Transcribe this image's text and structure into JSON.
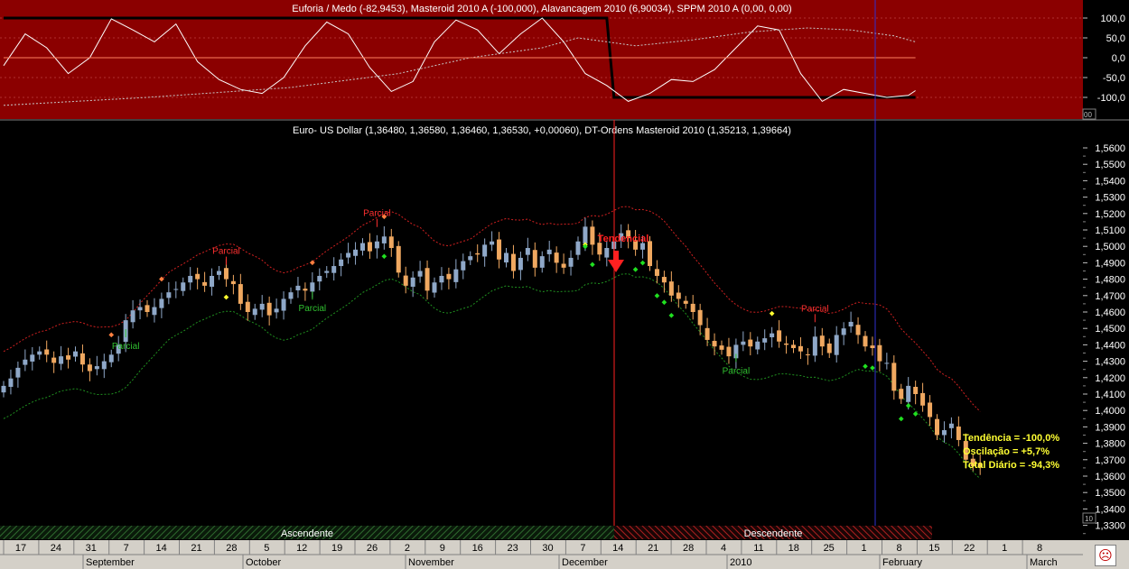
{
  "indicator_panel": {
    "title": "Euforia / Medo (-82,9453), Masteroid 2010 A (-100,000), Alavancagem 2010 (6,90034), SPPM 2010 A (0,00, 0,00)",
    "y_labels": [
      "100,0",
      "50,0",
      "0,0",
      "-50,0",
      "-100,0"
    ],
    "corner_label": "00"
  },
  "price_panel": {
    "title": "Euro- US Dollar (1,36480, 1,36580, 1,36460, 1,36530, +0,00060), DT-Ordens Masteroid 2010 (1,35213, 1,39664)",
    "corner_label": "10"
  },
  "annotations": {
    "parcial": "Parcial",
    "tendencial": "Tendencial",
    "ascendente": "Ascendente",
    "descendente": "Descendente"
  },
  "info_box": {
    "tendencia": "Tendência = -100,0%",
    "oscilacao": "Oscilação = +5,7%",
    "total": "Total Diário = -94,3%"
  },
  "status_icon": "sad-face-icon",
  "colors": {
    "indicator_bg": "#8b0000",
    "up_candle": "#8fa8c8",
    "down_candle": "#f0a860",
    "signal_line": "#ff2020",
    "event_line": "#3030d0",
    "info_text": "#ffff33"
  },
  "chart_data": [
    {
      "type": "line",
      "title": "Euforia / Medo (-82,9453), Masteroid 2010 A (-100,000), Alavancagem 2010 (6,90034), SPPM 2010 A (0,00, 0,00)",
      "ylim": [
        -135,
        135
      ],
      "yticks": [
        100,
        50,
        0,
        -50,
        -100
      ],
      "series": [
        {
          "name": "Masteroid 2010 A",
          "color": "#000000",
          "points": [
            [
              0,
              100
            ],
            [
              84,
              100
            ],
            [
              85,
              -100
            ],
            [
              127,
              -100
            ]
          ]
        },
        {
          "name": "Euforia / Medo",
          "color": "#ffffff",
          "points": [
            [
              0,
              -20
            ],
            [
              3,
              60
            ],
            [
              6,
              25
            ],
            [
              9,
              -40
            ],
            [
              12,
              0
            ],
            [
              15,
              98
            ],
            [
              18,
              70
            ],
            [
              21,
              40
            ],
            [
              24,
              85
            ],
            [
              27,
              -10
            ],
            [
              30,
              -55
            ],
            [
              33,
              -80
            ],
            [
              36,
              -90
            ],
            [
              39,
              -50
            ],
            [
              42,
              30
            ],
            [
              45,
              90
            ],
            [
              48,
              60
            ],
            [
              51,
              -25
            ],
            [
              54,
              -85
            ],
            [
              57,
              -60
            ],
            [
              60,
              40
            ],
            [
              63,
              95
            ],
            [
              66,
              70
            ],
            [
              69,
              10
            ],
            [
              72,
              60
            ],
            [
              75,
              100
            ],
            [
              78,
              40
            ],
            [
              81,
              -40
            ],
            [
              84,
              -70
            ],
            [
              87,
              -110
            ],
            [
              90,
              -90
            ],
            [
              93,
              -55
            ],
            [
              96,
              -60
            ],
            [
              99,
              -30
            ],
            [
              102,
              25
            ],
            [
              105,
              80
            ],
            [
              108,
              70
            ],
            [
              111,
              -40
            ],
            [
              114,
              -110
            ],
            [
              117,
              -80
            ],
            [
              120,
              -90
            ],
            [
              123,
              -100
            ],
            [
              126,
              -95
            ],
            [
              127,
              -83
            ]
          ]
        },
        {
          "name": "SPPM 2010 A",
          "color": "#c8c8c8",
          "points": [
            [
              0,
              -120
            ],
            [
              20,
              -100
            ],
            [
              40,
              -75
            ],
            [
              55,
              -40
            ],
            [
              65,
              0
            ],
            [
              75,
              25
            ],
            [
              80,
              50
            ],
            [
              88,
              30
            ],
            [
              96,
              45
            ],
            [
              104,
              65
            ],
            [
              112,
              75
            ],
            [
              118,
              70
            ],
            [
              124,
              55
            ],
            [
              127,
              40
            ]
          ]
        },
        {
          "name": "Alavancagem 2010",
          "color": "#ff8060",
          "points": [
            [
              0,
              0
            ],
            [
              127,
              0
            ]
          ]
        }
      ]
    },
    {
      "type": "candlestick",
      "title": "Euro- US Dollar (1,36480, 1,36580, 1,36460, 1,36530, +0,00060), DT-Ordens Masteroid 2010 (1,35213, 1,39664)",
      "ylim": [
        1.327,
        1.5685
      ],
      "yticks": [
        "1,5600",
        "1,5500",
        "1,5400",
        "1,5300",
        "1,5200",
        "1,5100",
        "1,5000",
        "1,4900",
        "1,4800",
        "1,4700",
        "1,4600",
        "1,4500",
        "1,4400",
        "1,4300",
        "1,4200",
        "1,4100",
        "1,4000",
        "1,3900",
        "1,3800",
        "1,3700",
        "1,3600",
        "1,3500",
        "1,3400",
        "1,3300"
      ],
      "x_day_labels": [
        "17",
        "24",
        "31",
        "7",
        "14",
        "21",
        "28",
        "5",
        "12",
        "19",
        "26",
        "2",
        "9",
        "16",
        "23",
        "30",
        "7",
        "14",
        "21",
        "28",
        "4",
        "11",
        "18",
        "25",
        "1",
        "8",
        "15",
        "22",
        "1",
        "8"
      ],
      "x_month_labels": [
        "September",
        "October",
        "November",
        "December",
        "2010",
        "February",
        "March"
      ],
      "close": [
        1.415,
        1.4195,
        1.426,
        1.431,
        1.434,
        1.436,
        1.434,
        1.429,
        1.433,
        1.431,
        1.436,
        1.428,
        1.424,
        1.427,
        1.43,
        1.434,
        1.44,
        1.455,
        1.461,
        1.463,
        1.46,
        1.463,
        1.468,
        1.472,
        1.474,
        1.478,
        1.482,
        1.48,
        1.476,
        1.482,
        1.485,
        1.48,
        1.477,
        1.465,
        1.46,
        1.462,
        1.465,
        1.458,
        1.462,
        1.468,
        1.472,
        1.476,
        1.473,
        1.478,
        1.482,
        1.485,
        1.488,
        1.492,
        1.496,
        1.498,
        1.502,
        1.497,
        1.503,
        1.506,
        1.499,
        1.484,
        1.476,
        1.481,
        1.485,
        1.473,
        1.478,
        1.482,
        1.48,
        1.486,
        1.491,
        1.494,
        1.495,
        1.501,
        1.503,
        1.492,
        1.496,
        1.485,
        1.493,
        1.499,
        1.487,
        1.494,
        1.498,
        1.49,
        1.487,
        1.493,
        1.503,
        1.512,
        1.501,
        1.495,
        1.499,
        1.503,
        1.508,
        1.505,
        1.498,
        1.502,
        1.488,
        1.482,
        1.478,
        1.47,
        1.468,
        1.465,
        1.46,
        1.452,
        1.443,
        1.439,
        1.437,
        1.433,
        1.44,
        1.442,
        1.439,
        1.442,
        1.444,
        1.447,
        1.442,
        1.44,
        1.438,
        1.436,
        1.434,
        1.445,
        1.439,
        1.435,
        1.446,
        1.45,
        1.454,
        1.446,
        1.439,
        1.438,
        1.43,
        1.429,
        1.412,
        1.407,
        1.415,
        1.41,
        1.403,
        1.396,
        1.385,
        1.388,
        1.392,
        1.382,
        1.37,
        1.366,
        1.3653
      ],
      "sell_signal_index": 84,
      "regime_labels": [
        "Ascendente",
        "Descendente"
      ]
    }
  ]
}
